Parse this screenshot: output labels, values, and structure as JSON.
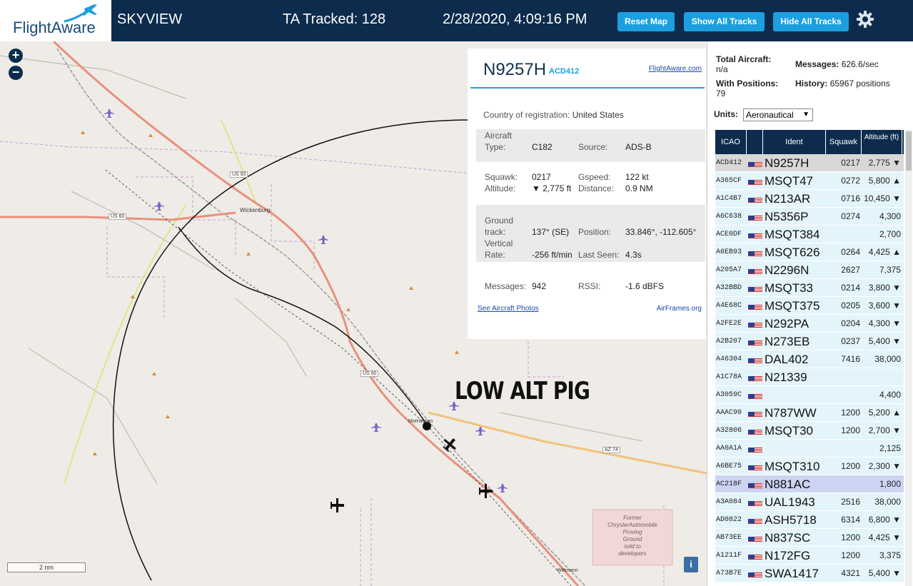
{
  "header": {
    "logo_text": "FlightAware",
    "app_name": "SKYVIEW",
    "tracked": "TA Tracked: 128",
    "datetime": "2/28/2020, 4:09:16 PM",
    "btn_reset": "Reset Map",
    "btn_show": "Show All Tracks",
    "btn_hide": "Hide All Tracks",
    "colors": {
      "bar": "#0d2c4d",
      "button": "#1c9fe0"
    }
  },
  "map": {
    "zoom_in": "+",
    "zoom_out": "−",
    "scale": "2 nm",
    "info": "i",
    "annotation": "LOW ALT PIG",
    "labels": {
      "wickenburg": "Wickenburg",
      "us93": "US 93",
      "us60a": "US 60",
      "us60b": "US 60",
      "az74": "AZ 74",
      "morristown": "Morristown",
      "wittmann": "Wittmann",
      "proving": [
        "Former",
        "ChryslerAutomobile",
        "Proving",
        "Ground",
        "sold to",
        "developers"
      ]
    }
  },
  "aircraft_panel": {
    "registration": "N9257H",
    "icao": "ACD412",
    "link": "FlightAware.com",
    "country_label": "Country of registration:",
    "country": "United States",
    "type_label": "Aircraft Type:",
    "type": "C182",
    "source_label": "Source:",
    "source": "ADS-B",
    "squawk_label": "Squawk:",
    "squawk": "0217",
    "altitude_label": "Altitude:",
    "altitude": "▼ 2,775 ft",
    "gspeed_label": "Gspeed:",
    "gspeed": "122 kt",
    "distance_label": "Distance:",
    "distance": "0.9 NM",
    "track_label": "Ground track:",
    "track": "137° (SE)",
    "position_label": "Position:",
    "position": "33.846°, -112.605°",
    "vrate_label": "Vertical Rate:",
    "vrate": "-256 ft/min",
    "lastseen_label": "Last Seen:",
    "lastseen": "4.3s",
    "messages_label": "Messages:",
    "messages": "942",
    "rssi_label": "RSSI:",
    "rssi": "-1.6 dBFS",
    "photos_link": "See Aircraft Photos",
    "airframes_link": "AirFrames.org"
  },
  "sidebar": {
    "total_label": "Total Aircraft:",
    "total": "n/a",
    "messages_label": "Messages:",
    "messages": "626.6/sec",
    "withpos_label": "With Positions:",
    "withpos": "79",
    "history_label": "History:",
    "history": "65967 positions",
    "units_label": "Units:",
    "units_value": "Aeronautical",
    "columns": [
      "ICAO",
      "Ident",
      "Squawk",
      "Altitude (ft)"
    ],
    "rows": [
      {
        "icao": "ACD412",
        "ident": "N9257H",
        "squawk": "0217",
        "alt": "2,775 ▼"
      },
      {
        "icao": "A365CF",
        "ident": "MSQT47",
        "squawk": "0272",
        "alt": "5,800 ▲"
      },
      {
        "icao": "A1C4B7",
        "ident": "N213AR",
        "squawk": "0716",
        "alt": "10,450 ▼"
      },
      {
        "icao": "A6C638",
        "ident": "N5356P",
        "squawk": "0274",
        "alt": "4,300"
      },
      {
        "icao": "ACE0DF",
        "ident": "MSQT384",
        "squawk": "",
        "alt": "2,700"
      },
      {
        "icao": "A6EB93",
        "ident": "MSQT626",
        "squawk": "0264",
        "alt": "4,425 ▲"
      },
      {
        "icao": "A205A7",
        "ident": "N2296N",
        "squawk": "2627",
        "alt": "7,375"
      },
      {
        "icao": "A32BBD",
        "ident": "MSQT33",
        "squawk": "0214",
        "alt": "3,800 ▼"
      },
      {
        "icao": "A4E68C",
        "ident": "MSQT375",
        "squawk": "0205",
        "alt": "3,600 ▼"
      },
      {
        "icao": "A2FE2E",
        "ident": "N292PA",
        "squawk": "0204",
        "alt": "4,300 ▼"
      },
      {
        "icao": "A2B207",
        "ident": "N273EB",
        "squawk": "0237",
        "alt": "5,400 ▼"
      },
      {
        "icao": "A46304",
        "ident": "DAL402",
        "squawk": "7416",
        "alt": "38,000"
      },
      {
        "icao": "A1C78A",
        "ident": "N21339",
        "squawk": "",
        "alt": ""
      },
      {
        "icao": "A3059C",
        "ident": "",
        "squawk": "",
        "alt": "4,400"
      },
      {
        "icao": "AAAC90",
        "ident": "N787WW",
        "squawk": "1200",
        "alt": "5,200 ▲"
      },
      {
        "icao": "A32806",
        "ident": "MSQT30",
        "squawk": "1200",
        "alt": "2,700 ▼"
      },
      {
        "icao": "AA0A1A",
        "ident": "",
        "squawk": "",
        "alt": "2,125"
      },
      {
        "icao": "A6BE75",
        "ident": "MSQT310",
        "squawk": "1200",
        "alt": "2,300 ▼"
      },
      {
        "icao": "AC218F",
        "ident": "N881AC",
        "squawk": "",
        "alt": "1,800"
      },
      {
        "icao": "A3A084",
        "ident": "UAL1943",
        "squawk": "2516",
        "alt": "38,000"
      },
      {
        "icao": "AD0822",
        "ident": "ASH5718",
        "squawk": "6314",
        "alt": "6,800 ▼"
      },
      {
        "icao": "AB73EE",
        "ident": "N837SC",
        "squawk": "1200",
        "alt": "4,425 ▼"
      },
      {
        "icao": "A1211F",
        "ident": "N172FG",
        "squawk": "1200",
        "alt": "3,375"
      },
      {
        "icao": "A73B7E",
        "ident": "SWA1417",
        "squawk": "4321",
        "alt": "5,400 ▼"
      }
    ]
  }
}
